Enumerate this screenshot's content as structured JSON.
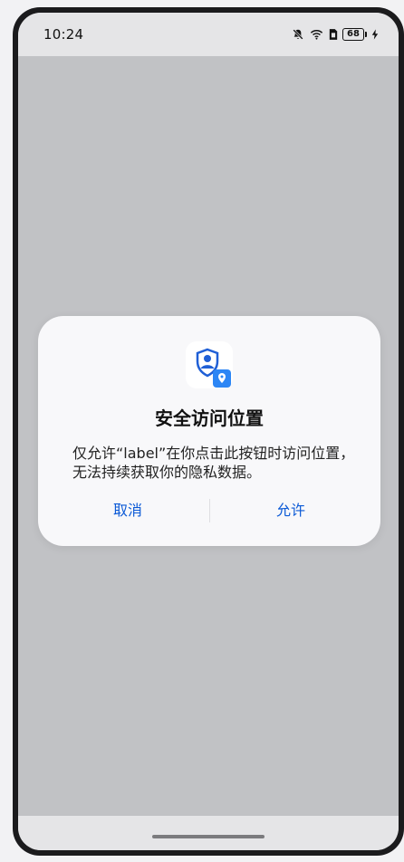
{
  "status_bar": {
    "time": "10:24",
    "battery_level": "68",
    "icons": [
      "bell-muted-icon",
      "wifi-icon",
      "sim-icon",
      "battery-icon",
      "charging-icon"
    ]
  },
  "dialog": {
    "icon": "shield-location-icon",
    "title": "安全访问位置",
    "message": "仅允许“label”在你点击此按钮时访问位置，无法持续获取你的隐私数据。",
    "cancel_label": "取消",
    "allow_label": "允许",
    "accent_color": "#0a59d6"
  }
}
